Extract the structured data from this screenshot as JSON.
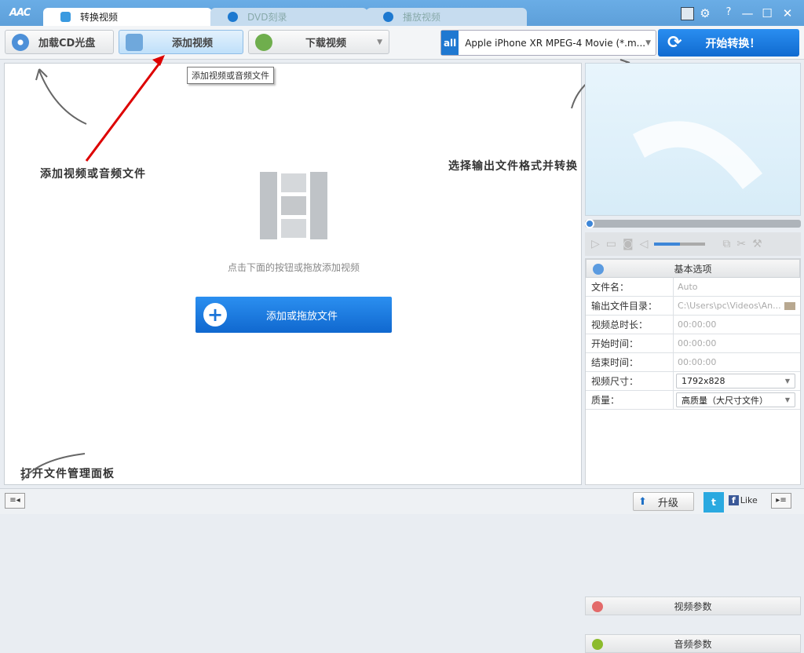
{
  "app": {
    "logo": "AAC"
  },
  "tabs": [
    {
      "label": "转换视频"
    },
    {
      "label": "DVD刻录"
    },
    {
      "label": "播放视频"
    }
  ],
  "window_controls": {
    "help": "?",
    "minimize": "—",
    "maximize": "☐",
    "close": "✕"
  },
  "toolbar": {
    "load_cd": "加载CD光盘",
    "add_video": "添加视频",
    "download_video": "下载视频",
    "tooltip": "添加视频或音频文件",
    "format_icon_label": "all",
    "format": "Apple iPhone XR MPEG-4 Movie (*.m...",
    "start": "开始转换！"
  },
  "main": {
    "hint": "点击下面的按钮或拖放添加视频",
    "add_button": "添加或拖放文件"
  },
  "annotations": {
    "add": "添加视频或音频文件",
    "select": "选择输出文件格式并转换",
    "panel": "打开文件管理面板"
  },
  "player": {
    "volume_percent": 50,
    "progress_percent": 0
  },
  "options": {
    "basic_title": "基本选项",
    "rows": [
      {
        "label": "文件名：",
        "value": "Auto"
      },
      {
        "label": "输出文件目录：",
        "value": "C:\\Users\\pc\\Videos\\An..."
      },
      {
        "label": "视频总时长：",
        "value": "00:00:00"
      },
      {
        "label": "开始时间：",
        "value": "00:00:00"
      },
      {
        "label": "结束时间：",
        "value": "00:00:00"
      },
      {
        "label": "视频尺寸：",
        "value": "1792x828"
      },
      {
        "label": "质量：",
        "value": "高质量（大尺寸文件）"
      }
    ],
    "video_params": "视频参数",
    "audio_params": "音频参数"
  },
  "bottom": {
    "upgrade": "升级",
    "like": "Like"
  }
}
